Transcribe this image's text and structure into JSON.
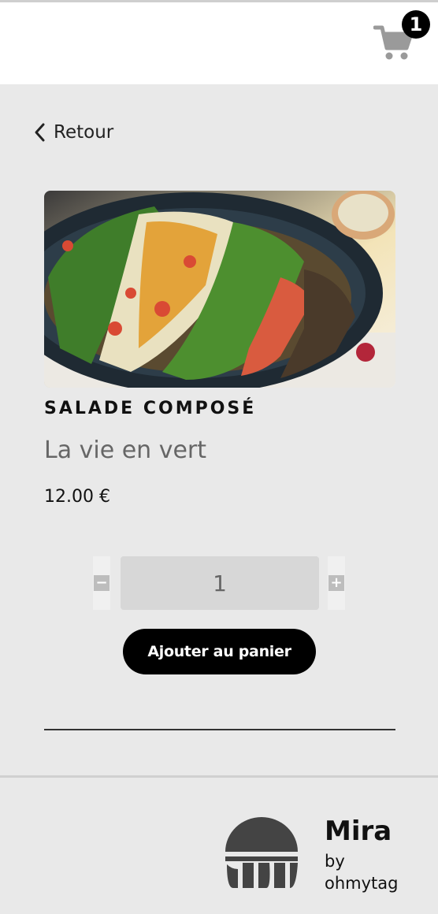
{
  "header": {
    "cart_icon": "shopping-cart-icon",
    "cart_count": "1"
  },
  "nav": {
    "back_icon": "chevron-left-icon",
    "back_label": "Retour"
  },
  "product": {
    "image": "salad-bowl-photo",
    "category": "SALADE COMPOSÉ",
    "name": "La vie en vert",
    "price": "12.00 €",
    "quantity": "1",
    "decrement_label": "−",
    "increment_label": "+",
    "add_to_cart_label": "Ajouter au panier"
  },
  "footer": {
    "logo_icon": "mira-logo-icon",
    "brand_name": "Mira",
    "by_label": "by",
    "company": "ohmytag"
  },
  "colors": {
    "accent": "#000000",
    "page_background": "#e9e9e9",
    "header_background": "#ffffff",
    "cart_icon": "#9a9a9a",
    "muted_text": "#666666"
  }
}
